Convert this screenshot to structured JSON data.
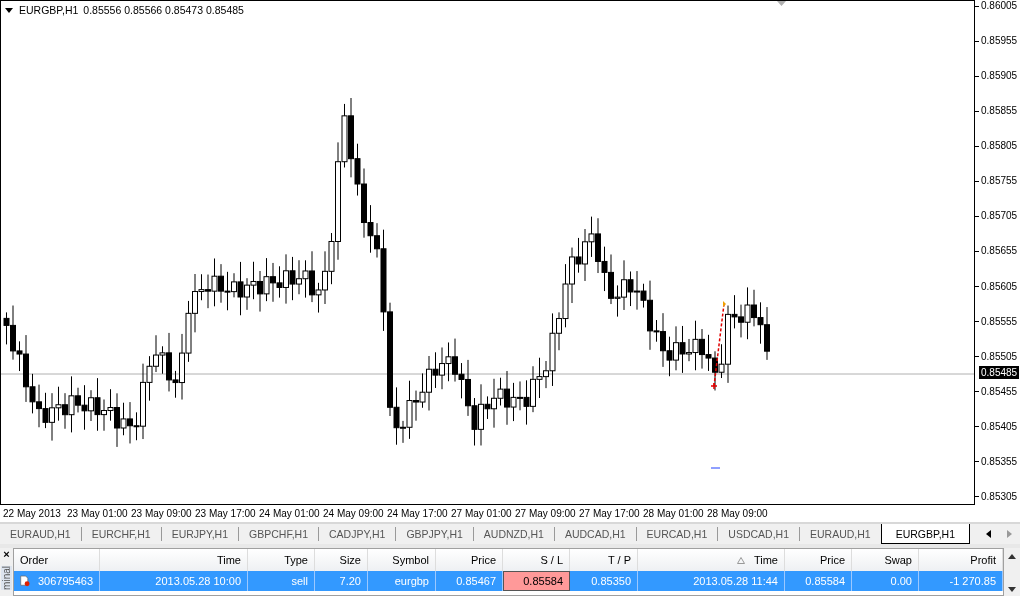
{
  "chart": {
    "symbol": "EURGBP,H1",
    "ohlc": "0.85556 0.85566 0.85473 0.85485",
    "price_ticks": [
      "0.86005",
      "0.85955",
      "0.85905",
      "0.85855",
      "0.85805",
      "0.85755",
      "0.85705",
      "0.85655",
      "0.85605",
      "0.85555",
      "0.85505",
      "0.85455",
      "0.85405",
      "0.85355",
      "0.85305"
    ],
    "current_price": "0.85485",
    "time_labels": [
      "22 May 2013",
      "23 May 01:00",
      "23 May 09:00",
      "23 May 17:00",
      "24 May 01:00",
      "24 May 09:00",
      "24 May 17:00",
      "27 May 01:00",
      "27 May 09:00",
      "27 May 17:00",
      "28 May 01:00",
      "28 May 09:00"
    ]
  },
  "tabs": [
    {
      "label": "EURAUD,H1",
      "selected": false
    },
    {
      "label": "EURCHF,H1",
      "selected": false
    },
    {
      "label": "EURJPY,H1",
      "selected": false
    },
    {
      "label": "GBPCHF,H1",
      "selected": false
    },
    {
      "label": "CADJPY,H1",
      "selected": false
    },
    {
      "label": "GBPJPY,H1",
      "selected": false
    },
    {
      "label": "AUDNZD,H1",
      "selected": false
    },
    {
      "label": "AUDCAD,H1",
      "selected": false
    },
    {
      "label": "EURCAD,H1",
      "selected": false
    },
    {
      "label": "USDCAD,H1",
      "selected": false
    },
    {
      "label": "EURAUD,H1",
      "selected": false
    },
    {
      "label": "EURGBP,H1",
      "selected": true
    }
  ],
  "terminal": {
    "close": "×",
    "side_label": "minal",
    "columns": [
      {
        "label": "Order",
        "sorted": false
      },
      {
        "label": "Time",
        "sorted": false
      },
      {
        "label": "Type",
        "sorted": false
      },
      {
        "label": "Size",
        "sorted": false
      },
      {
        "label": "Symbol",
        "sorted": false
      },
      {
        "label": "Price",
        "sorted": false
      },
      {
        "label": "S / L",
        "sorted": false
      },
      {
        "label": "T / P",
        "sorted": false
      },
      {
        "label": "Time",
        "sorted": true
      },
      {
        "label": "Price",
        "sorted": false
      },
      {
        "label": "Swap",
        "sorted": false
      },
      {
        "label": "Profit",
        "sorted": false
      }
    ],
    "rows": [
      {
        "selected": true,
        "sl_alert": true,
        "cells": [
          "306795463",
          "2013.05.28 10:00",
          "sell",
          "7.20",
          "eurgbp",
          "0.85467",
          "0.85584",
          "0.85350",
          "2013.05.28 11:44",
          "0.85584",
          "0.00",
          "-1 270.85"
        ]
      }
    ]
  }
}
